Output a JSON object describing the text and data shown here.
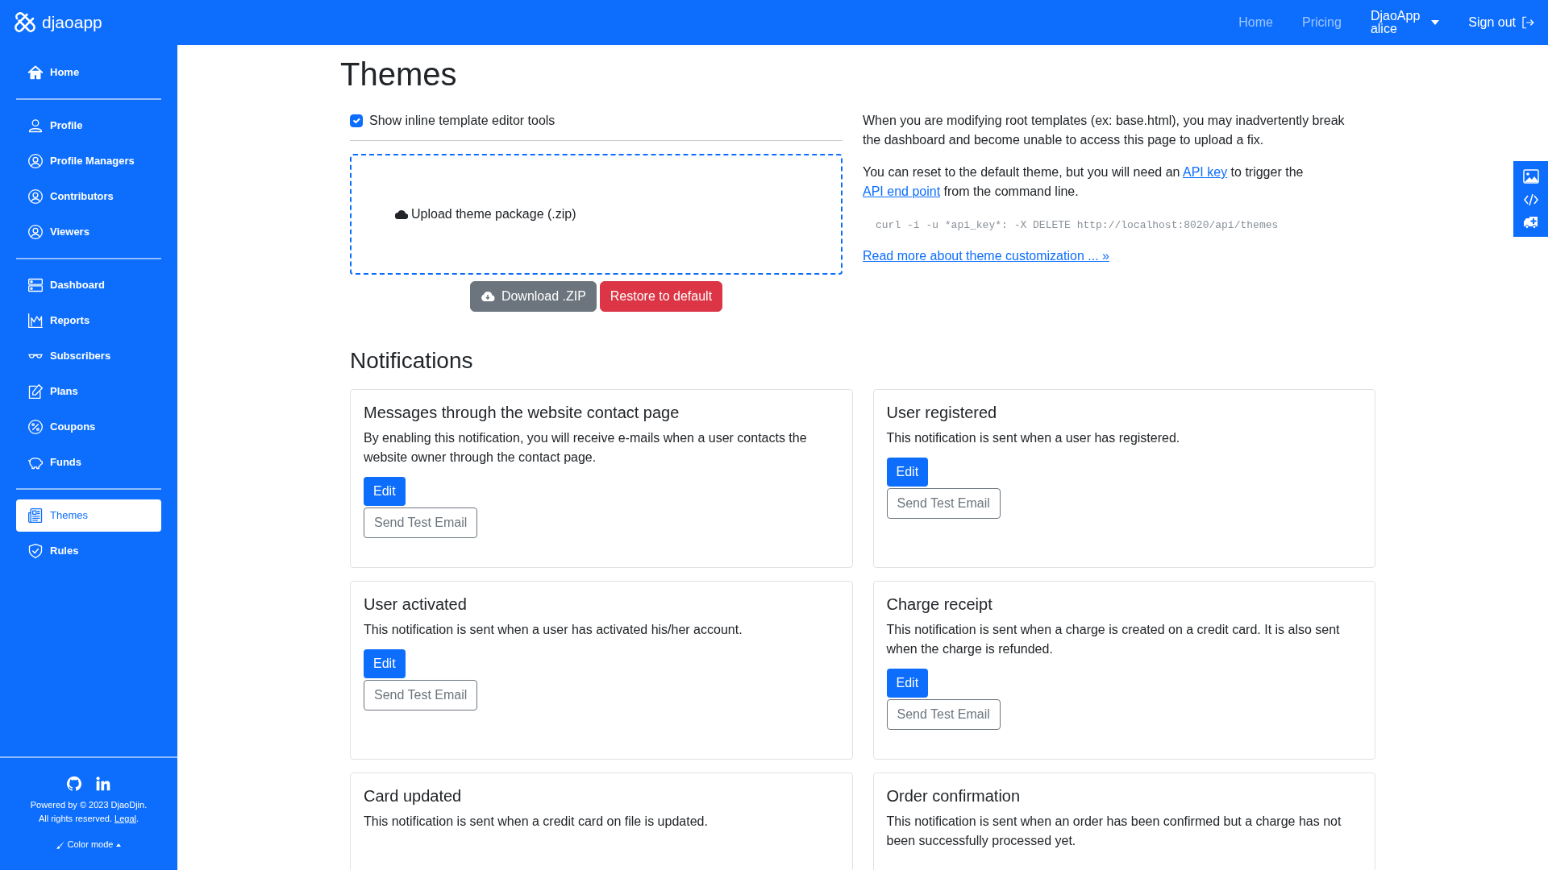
{
  "brand": {
    "name": "djaoapp"
  },
  "topnav": {
    "links": [
      {
        "label": "Home"
      },
      {
        "label": "Pricing"
      }
    ],
    "account": {
      "line_1": "DjaoApp",
      "line_2": "alice"
    },
    "sign_out": "Sign out"
  },
  "sidebar": {
    "groups": [
      [
        {
          "label": "Home",
          "selected": false
        }
      ],
      [
        {
          "label": "Profile",
          "selected": false
        },
        {
          "label": "Profile Managers",
          "selected": false
        },
        {
          "label": "Contributors",
          "selected": false
        },
        {
          "label": "Viewers",
          "selected": false
        }
      ],
      [
        {
          "label": "Dashboard",
          "selected": false
        },
        {
          "label": "Reports",
          "selected": false
        },
        {
          "label": "Subscribers",
          "selected": false
        },
        {
          "label": "Plans",
          "selected": false
        },
        {
          "label": "Coupons",
          "selected": false
        },
        {
          "label": "Funds",
          "selected": false
        }
      ],
      [
        {
          "label": "Themes",
          "selected": true
        },
        {
          "label": "Rules",
          "selected": false
        }
      ]
    ],
    "footer": {
      "powered": "Powered by © 2023 DjaoDjin.",
      "rights": "All rights reserved. ",
      "legal": "Legal",
      "rights_end": ".",
      "color_mode": "Color mode"
    }
  },
  "theme": {
    "title": "Themes",
    "inline_tools": {
      "label": "Show inline template editor tools",
      "checked": true
    },
    "upload": {
      "label": "Upload theme package (.zip)"
    },
    "download": "Download .ZIP",
    "restore": "Restore to default",
    "info": {
      "paragraph_1": "When you are modifying root templates (ex: base.html), you may inadvertently break the dashboard and become unable to access this page to upload a fix.",
      "paragraph_2": [
        {
          "kind": "text",
          "text": "You can reset to the default theme, but you will need an "
        },
        {
          "kind": "link",
          "text": "API key"
        },
        {
          "kind": "text",
          "text": " to trigger the "
        },
        {
          "kind": "link",
          "text": "API end point"
        },
        {
          "kind": "text",
          "text": " from the command line."
        }
      ],
      "command": "curl -i -u *api_key*: -X DELETE http://localhost:8020/api/themes",
      "read_more": "Read more about theme customization ... »"
    }
  },
  "notifications": {
    "title": "Notifications",
    "cards": [
      {
        "title": "Messages through the website contact page",
        "description": "By enabling this notification, you will receive e-mails when a user contacts the website owner through the contact page.",
        "edit": "Edit",
        "test": "Send Test Email"
      },
      {
        "title": "User registered",
        "description": "This notification is sent when a user has registered.",
        "edit": "Edit",
        "test": "Send Test Email"
      },
      {
        "title": "User activated",
        "description": "This notification is sent when a user has activated his/her account.",
        "edit": "Edit",
        "test": "Send Test Email"
      },
      {
        "title": "Charge receipt",
        "description": "This notification is sent when a charge is created on a credit card. It is also sent when the charge is refunded.",
        "edit": "Edit",
        "test": "Send Test Email"
      },
      {
        "title": "Card updated",
        "description": "This notification is sent when a credit card on file is updated."
      },
      {
        "title": "Order confirmation",
        "description": "This notification is sent when an order has been confirmed but a charge has not been successfully processed yet."
      }
    ]
  }
}
